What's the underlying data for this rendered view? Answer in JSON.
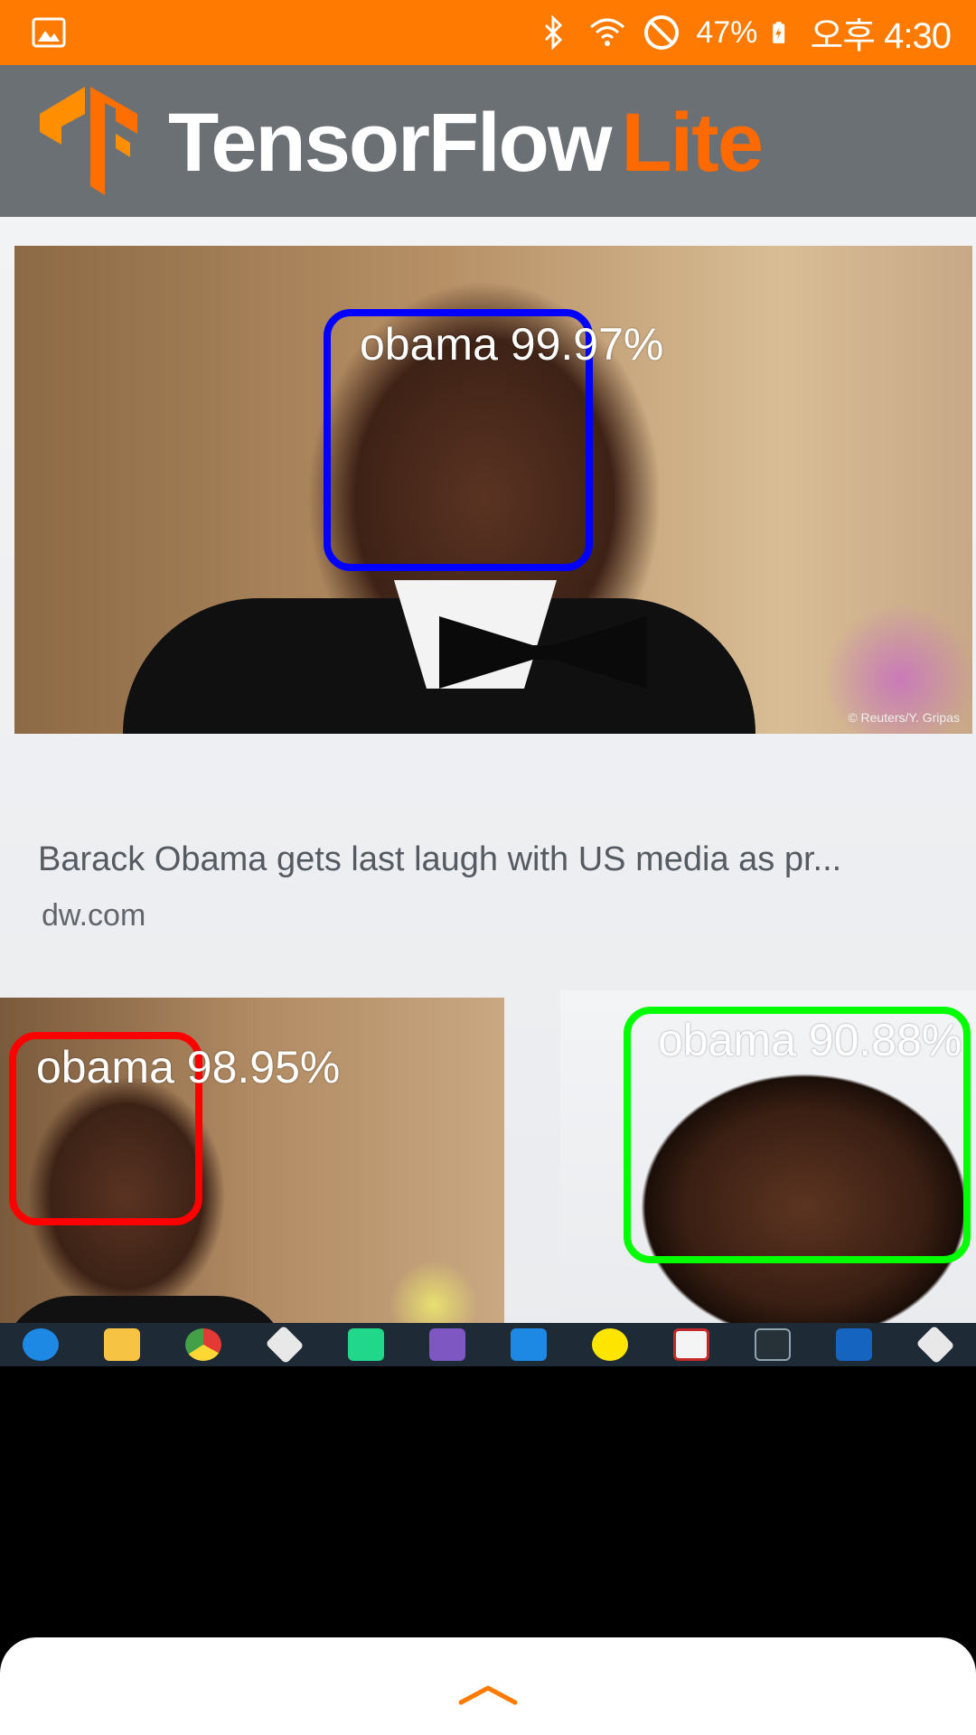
{
  "status_bar": {
    "left_icon": "gallery-notification-icon",
    "icons": [
      "bluetooth-icon",
      "wifi-icon",
      "do-not-disturb-icon",
      "battery-charging-icon"
    ],
    "battery": "47%",
    "time": "오후 4:30",
    "background_color": "#FF7A00"
  },
  "app_header": {
    "logo_icon": "tensorflow-logo-icon",
    "title_main": "TensorFlow",
    "title_accent": "Lite",
    "accent_color": "#FF6A00"
  },
  "camera_view": {
    "caption": "Barack Obama gets last laugh with US media as pr...",
    "source": "dw.com",
    "photo_credit": "© Reuters/Y. Gripas"
  },
  "detections": [
    {
      "label": "obama 99.97%",
      "color": "#0000FF"
    },
    {
      "label": "obama 98.95%",
      "color": "#FF0000"
    },
    {
      "label": "obama 90.88%",
      "color": "#00FF00"
    }
  ],
  "taskbar_icons": [
    "edge-icon",
    "file-explorer-icon",
    "chrome-icon",
    "git-icon",
    "pycharm-icon",
    "visual-studio-icon",
    "vscode-icon",
    "kakaotalk-icon",
    "filezilla-icon",
    "terminal-icon",
    "word-icon",
    "git-icon"
  ],
  "bottom_sheet": {
    "toggle_icon": "chevron-up-icon"
  }
}
